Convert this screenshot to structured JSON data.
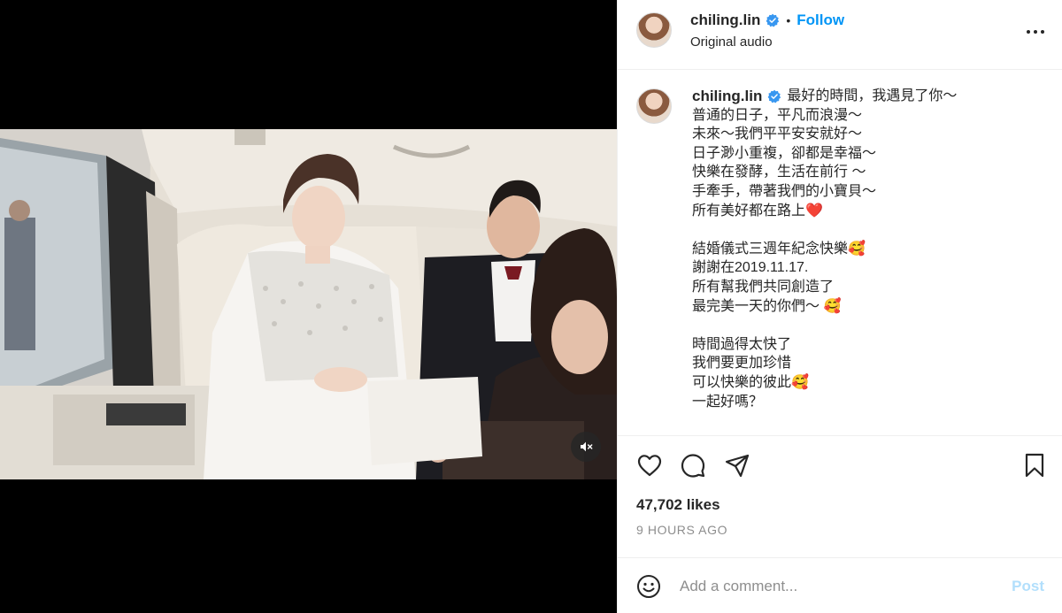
{
  "post": {
    "username": "chiling.lin",
    "follow_label": "Follow",
    "separator": "•",
    "audio": "Original audio",
    "more_icon": "more-horizontal-icon"
  },
  "caption": {
    "username": "chiling.lin",
    "first_line": "最好的時間，我遇見了你～",
    "lines": [
      "普通的日子，平凡而浪漫～",
      "未來～我們平平安安就好～",
      "日子渺小重複，卻都是幸福～",
      "快樂在發酵，生活在前行 ～",
      "手牽手，帶著我們的小寶貝～",
      "所有美好都在路上❤️",
      "",
      "結婚儀式三週年紀念快樂🥰",
      "謝謝在2019.11.17.",
      "所有幫我們共同創造了",
      "最完美一天的你們～ 🥰",
      "",
      "時間過得太快了",
      "我們要更加珍惜",
      "可以快樂的彼此🥰",
      "一起好嗎？"
    ]
  },
  "stats": {
    "likes": "47,702 likes",
    "time": "9 HOURS AGO"
  },
  "comment": {
    "placeholder": "Add a comment...",
    "post_label": "Post"
  },
  "colors": {
    "accent": "#0095f6",
    "post_disabled": "#b2dffc",
    "verified": "#3897f0"
  }
}
